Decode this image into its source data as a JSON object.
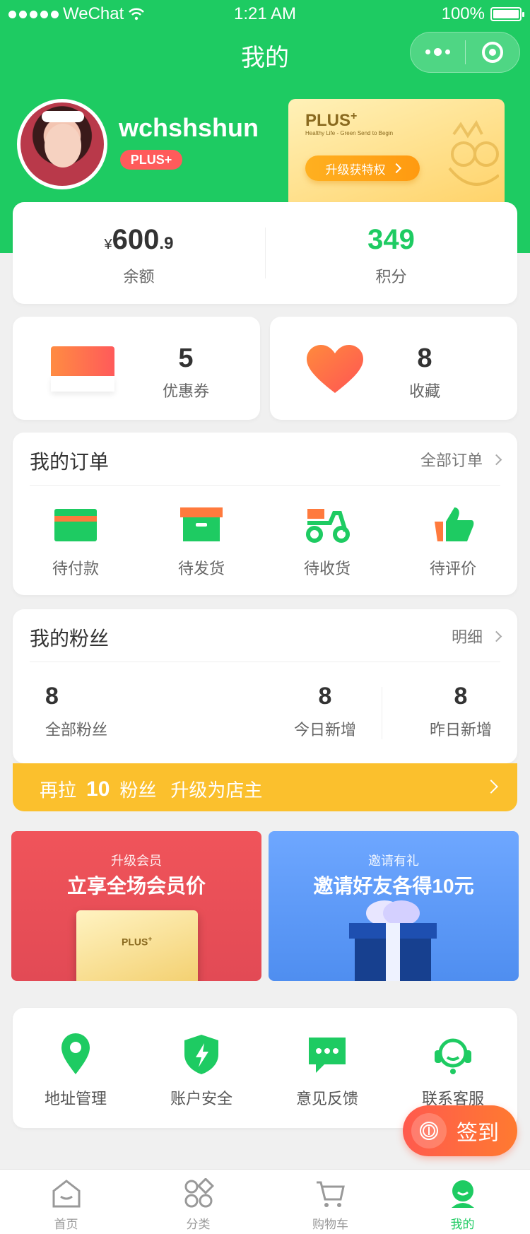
{
  "status_bar": {
    "carrier": "WeChat",
    "time": "1:21 AM",
    "battery": "100%"
  },
  "nav": {
    "title": "我的"
  },
  "user": {
    "name": "wchshshun",
    "badge": "PLUS+"
  },
  "plus_card": {
    "logo": "PLUS",
    "sup": "+",
    "tagline": "Healthy Life - Green Send to Begin",
    "button": "升级获特权"
  },
  "balance": {
    "currency": "¥",
    "int": "600",
    "frac": ".9",
    "label": "余额"
  },
  "points": {
    "value": "349",
    "label": "积分"
  },
  "coupons": {
    "value": "5",
    "label": "优惠券"
  },
  "favorites": {
    "value": "8",
    "label": "收藏"
  },
  "orders": {
    "title": "我的订单",
    "link": "全部订单",
    "items": [
      {
        "label": "待付款",
        "icon": "card-icon"
      },
      {
        "label": "待发货",
        "icon": "box-icon"
      },
      {
        "label": "待收货",
        "icon": "delivery-scooter-icon"
      },
      {
        "label": "待评价",
        "icon": "thumbs-up-icon"
      }
    ]
  },
  "fans": {
    "title": "我的粉丝",
    "link": "明细",
    "all": {
      "value": "8",
      "label": "全部粉丝"
    },
    "today": {
      "value": "8",
      "label": "今日新增"
    },
    "yesterday": {
      "value": "8",
      "label": "昨日新增"
    }
  },
  "upgrade_banner": {
    "prefix": "再拉",
    "count": "10",
    "suffix": "粉丝",
    "goal": "升级为店主"
  },
  "promos": {
    "member": {
      "sub": "升级会员",
      "main": "立享全场会员价",
      "card_logo": "PLUS"
    },
    "invite": {
      "sub": "邀请有礼",
      "main": "邀请好友各得10元"
    }
  },
  "settings": [
    {
      "label": "地址管理",
      "icon": "location-pin-icon"
    },
    {
      "label": "账户安全",
      "icon": "shield-bolt-icon"
    },
    {
      "label": "意见反馈",
      "icon": "chat-bubble-icon"
    },
    {
      "label": "联系客服",
      "icon": "headset-icon"
    }
  ],
  "signin": {
    "label": "签到"
  },
  "tabbar": [
    {
      "label": "首页",
      "icon": "home-icon"
    },
    {
      "label": "分类",
      "icon": "category-icon"
    },
    {
      "label": "购物车",
      "icon": "cart-icon"
    },
    {
      "label": "我的",
      "icon": "profile-icon",
      "active": true
    }
  ],
  "colors": {
    "brand": "#1ecb62",
    "banner": "#fbc02d",
    "danger": "#ff5b5b",
    "member": "#e24a55",
    "invite": "#5b97f5"
  }
}
